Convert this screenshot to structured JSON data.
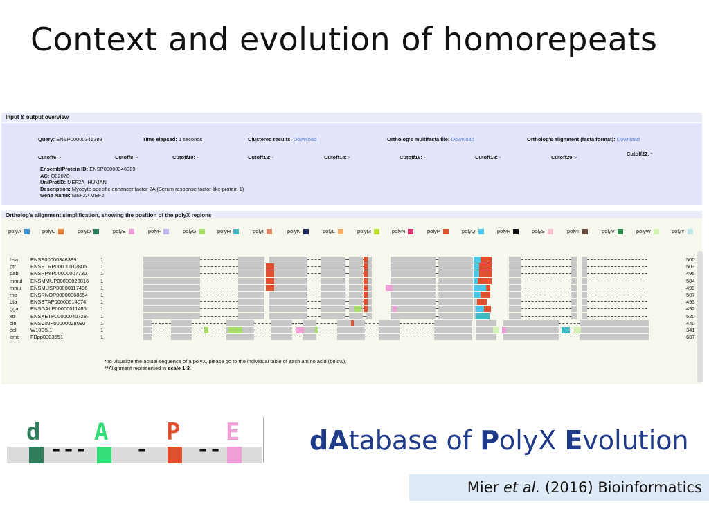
{
  "slide_title": "Context and evolution of homorepeats",
  "io_header": "Input & output overview",
  "query": {
    "label": "Query:",
    "value": "ENSP00000346389"
  },
  "time": {
    "label": "Time elapsed:",
    "value": "1 seconds"
  },
  "clustered": {
    "label": "Clustered results:",
    "link": "Download"
  },
  "multifasta": {
    "label": "Ortholog's multifasta file:",
    "link": "Download"
  },
  "alignment_file": {
    "label": "Ortholog's alignment (fasta format):",
    "link": "Download"
  },
  "cutoffs": [
    {
      "label": "Cutoff6:",
      "value": "-"
    },
    {
      "label": "Cutoff8:",
      "value": "-"
    },
    {
      "label": "Cutoff10:",
      "value": "-"
    },
    {
      "label": "Cutoff12:",
      "value": "-"
    },
    {
      "label": "Cutoff14:",
      "value": "-"
    },
    {
      "label": "Cutoff16:",
      "value": "-"
    },
    {
      "label": "Cutoff18:",
      "value": "-"
    },
    {
      "label": "Cutoff20:",
      "value": "-"
    },
    {
      "label": "Cutoff22:",
      "value": "-"
    }
  ],
  "gene_info": {
    "ensembl": {
      "label": "EnsemblProtein ID:",
      "value": "ENSP00000346389"
    },
    "ac": {
      "label": "AC:",
      "value": "Q02078"
    },
    "uniprot": {
      "label": "UniProtID:",
      "value": "MEF2A_HUMAN"
    },
    "description": {
      "label": "Description:",
      "value": "Myocyte-specific enhancer factor 2A (Serum response factor-like protein 1)"
    },
    "gene": {
      "label": "Gene Name:",
      "value": "MEF2A MEF2"
    }
  },
  "align_header": "Ortholog's alignment simplification, showing the position of the polyX regions",
  "legend": [
    {
      "name": "polyA",
      "color": "#3a8fd1"
    },
    {
      "name": "polyC",
      "color": "#e8823a"
    },
    {
      "name": "polyD",
      "color": "#2e7d5b"
    },
    {
      "name": "polyE",
      "color": "#ee9fd6"
    },
    {
      "name": "polyF",
      "color": "#b9b4ee"
    },
    {
      "name": "polyG",
      "color": "#a6dd6b"
    },
    {
      "name": "polyH",
      "color": "#3fbcc3"
    },
    {
      "name": "polyI",
      "color": "#e0856b"
    },
    {
      "name": "polyK",
      "color": "#1d2a5c"
    },
    {
      "name": "polyL",
      "color": "#f0b06b"
    },
    {
      "name": "polyM",
      "color": "#b6dc2c"
    },
    {
      "name": "polyN",
      "color": "#e0306e"
    },
    {
      "name": "polyP",
      "color": "#e0502e"
    },
    {
      "name": "polyQ",
      "color": "#4cc7e6"
    },
    {
      "name": "polyR",
      "color": "#111111"
    },
    {
      "name": "polyS",
      "color": "#f4c1c6"
    },
    {
      "name": "polyT",
      "color": "#6b4a3a"
    },
    {
      "name": "polyV",
      "color": "#2e8a4a"
    },
    {
      "name": "polyW",
      "color": "#d6f1b6"
    },
    {
      "name": "polyY",
      "color": "#bfe6e6"
    }
  ],
  "rows": [
    {
      "code": "hsa",
      "pid": "ENSP00000346389",
      "one": "1",
      "len": "500"
    },
    {
      "code": "ptr",
      "pid": "ENSPTRP00000012805",
      "one": "1",
      "len": "503"
    },
    {
      "code": "pab",
      "pid": "ENSPPYP00000007730",
      "one": "1",
      "len": "495"
    },
    {
      "code": "mmul",
      "pid": "ENSMMUP00000023816",
      "one": "1",
      "len": "504"
    },
    {
      "code": "mmu",
      "pid": "ENSMUSP00000117496",
      "one": "1",
      "len": "499"
    },
    {
      "code": "rno",
      "pid": "ENSRNOP00000068554",
      "one": "1",
      "len": "507"
    },
    {
      "code": "bta",
      "pid": "ENSBTAP00000014074",
      "one": "1",
      "len": "493"
    },
    {
      "code": "gga",
      "pid": "ENSGALP00000011486",
      "one": "1",
      "len": "492"
    },
    {
      "code": "xtr",
      "pid": "ENSXETP00000040728",
      "one": "1",
      "len": "520"
    },
    {
      "code": "cin",
      "pid": "ENSCINP00000028090",
      "one": "1",
      "len": "440"
    },
    {
      "code": "cel",
      "pid": "W10D5.1",
      "one": "1",
      "len": "341"
    },
    {
      "code": "dme",
      "pid": "FBpp0303551",
      "one": "1",
      "len": "607"
    }
  ],
  "notes": [
    "*To visualize the actual sequence of a polyX, please go to the individual table of each amino acid (below).",
    "**Alignment represented in scale 1:3."
  ],
  "notes_prefix": "**Alignment represented in ",
  "notes_scale": "scale 1:3",
  "notes_suffix": ".",
  "logo": {
    "letters": [
      "d",
      "A",
      "P",
      "E"
    ],
    "letter_colors": [
      "#2e7d5b",
      "#33dd77",
      "#e0502e",
      "#ee9fd6"
    ],
    "dashes": [
      "---",
      "-",
      "--"
    ]
  },
  "db_name": {
    "p1": "d",
    "p2": "A",
    "p3": "tabase of ",
    "p4": "P",
    "p5": "olyX ",
    "p6": "E",
    "p7": "volution"
  },
  "citation": {
    "authors": "Mier ",
    "etal": "et al.",
    "rest": " (2016) Bioinformatics"
  }
}
